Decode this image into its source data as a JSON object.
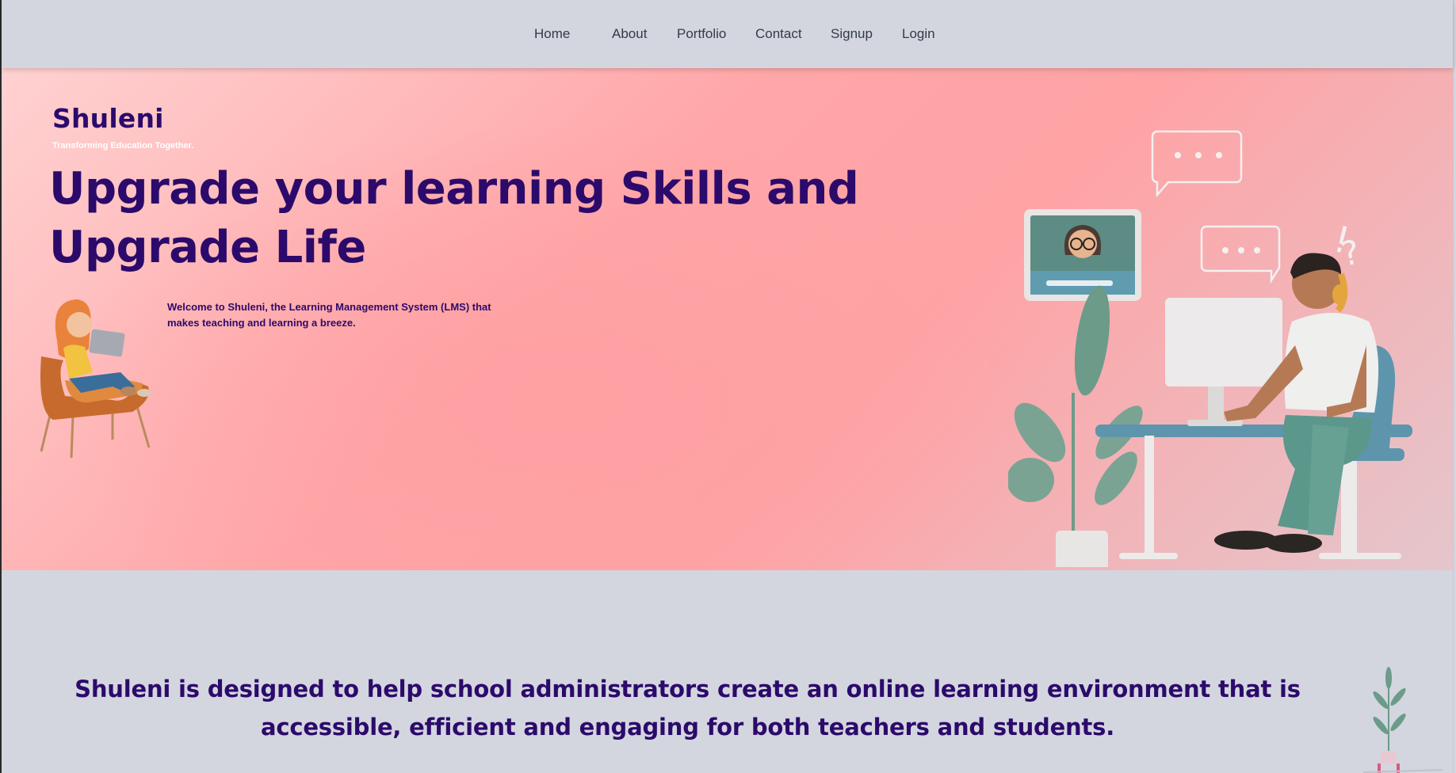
{
  "nav": {
    "items": [
      {
        "label": "Home"
      },
      {
        "label": "About"
      },
      {
        "label": "Portfolio"
      },
      {
        "label": "Contact"
      },
      {
        "label": "Signup"
      },
      {
        "label": "Login"
      }
    ]
  },
  "hero": {
    "brand": "Shuleni",
    "tagline": "Transforming Education Together.",
    "title": "Upgrade your learning Skills and Upgrade Life",
    "welcome": "Welcome to Shuleni, the Learning Management System (LMS) that makes teaching and learning a breeze."
  },
  "about": {
    "text": "Shuleni is designed to help school administrators create an online learning environment that is accessible, efficient and engaging for both teachers and students."
  },
  "colors": {
    "brand_purple": "#2c0a6b",
    "hero_pink": "#ffa6a8",
    "page_background": "#d3d6de"
  }
}
